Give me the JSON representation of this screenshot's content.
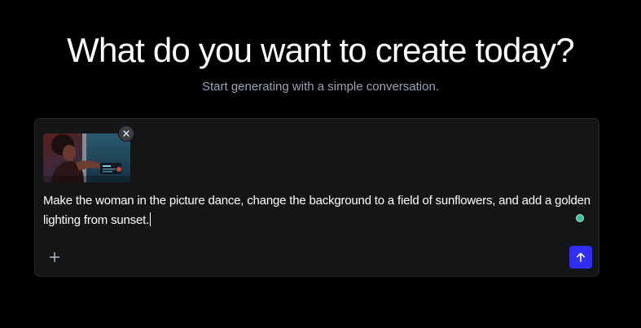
{
  "hero": {
    "title": "What do you want to create today?",
    "subtitle": "Start generating with a simple conversation."
  },
  "composer": {
    "prompt": "Make the woman in the picture dance, change the background to a field of sunflowers, and add a golden lighting from sunset.",
    "attachment": {
      "remove_icon": "close-icon"
    },
    "add_icon": "plus-icon",
    "send_icon": "arrow-up-icon",
    "status_icon": "status-dot-icon"
  },
  "colors": {
    "background": "#000000",
    "panel": "#141517",
    "subtitle": "#9aa3b8",
    "send_button": "#2f2ef4",
    "status_dot": "#3fbf9d"
  }
}
